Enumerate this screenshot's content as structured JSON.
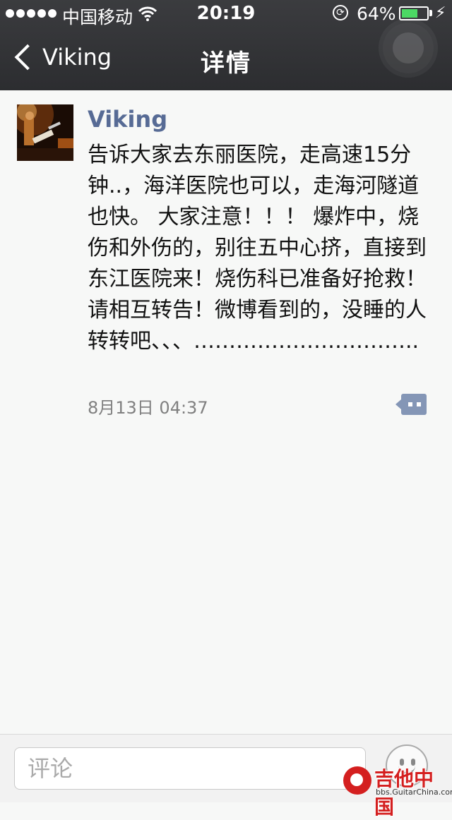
{
  "status_bar": {
    "carrier": "中国移动",
    "time": "20:19",
    "battery_percent": "64%",
    "battery_level": 0.64
  },
  "nav": {
    "back_label": "Viking",
    "title": "详情"
  },
  "post": {
    "author": "Viking",
    "text": "告诉大家去东丽医院，走高速15分钟..，海洋医院也可以，走海河隧道也快。 大家注意！！！ 爆炸中，烧伤和外伤的，别往五中心挤，直接到东江医院来！烧伤科已准备好抢救！请相互转告！微博看到的，没睡的人转转吧、、、…………………………..",
    "timestamp": "8月13日 04:37"
  },
  "comment_bar": {
    "placeholder": "评论"
  },
  "watermark": {
    "text": "吉他中国",
    "url": "bbs.GuitarChina.com"
  },
  "colors": {
    "author": "#576b95",
    "navbar": "#2c2d30",
    "battery": "#4cd964",
    "watermark": "#d41f1f"
  }
}
